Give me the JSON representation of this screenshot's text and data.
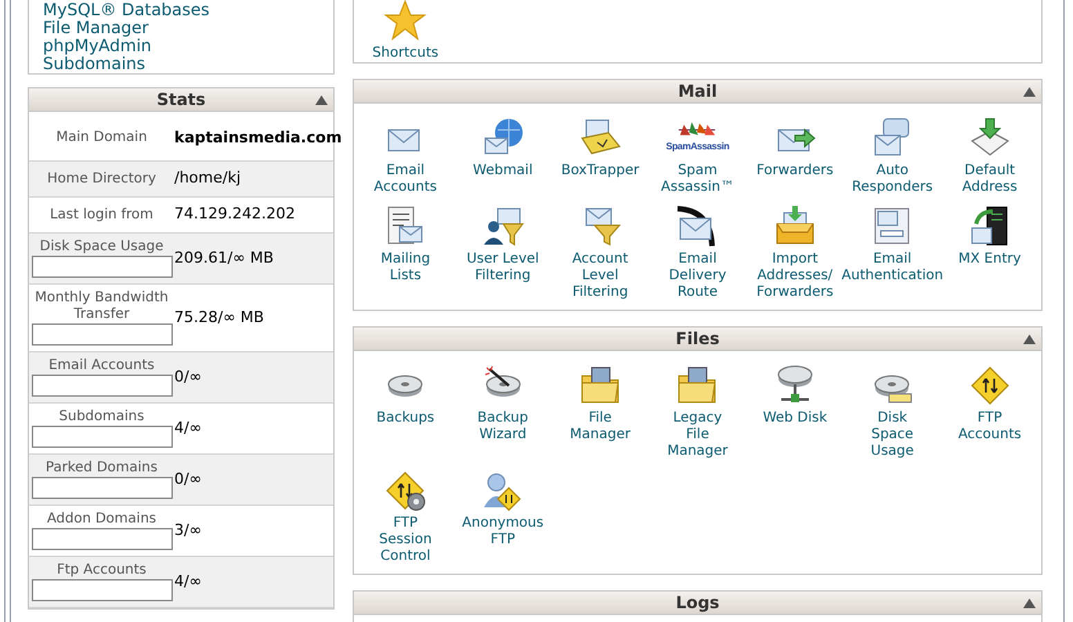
{
  "sidebar_links": [
    "MySQL® Databases",
    "File Manager",
    "phpMyAdmin",
    "Subdomains"
  ],
  "stats": {
    "title": "Stats",
    "rows": [
      {
        "kind": "text",
        "label": "Main Domain",
        "value": "kaptainsmedia.com",
        "bold": true
      },
      {
        "kind": "text",
        "label": "Home Directory",
        "value": "/home/kj",
        "bold": false
      },
      {
        "kind": "text",
        "label": "Last login from",
        "value": "74.129.242.202",
        "bold": false
      },
      {
        "kind": "meter",
        "label": "Disk Space Usage",
        "value": "209.61/∞ MB",
        "level": 0
      },
      {
        "kind": "meter",
        "label": "Monthly Bandwidth Transfer",
        "value": "75.28/∞ MB",
        "level": 0
      },
      {
        "kind": "meter",
        "label": "Email Accounts",
        "value": "0/∞",
        "level": 0
      },
      {
        "kind": "meter",
        "label": "Subdomains",
        "value": "4/∞",
        "level": 0
      },
      {
        "kind": "meter",
        "label": "Parked Domains",
        "value": "0/∞",
        "level": 0
      },
      {
        "kind": "meter",
        "label": "Addon Domains",
        "value": "3/∞",
        "level": 0
      },
      {
        "kind": "meter",
        "label": "Ftp Accounts",
        "value": "4/∞",
        "level": 0
      }
    ]
  },
  "shortcuts": [
    {
      "kind": "star",
      "lines": [
        "Shortcuts"
      ]
    }
  ],
  "sections": [
    {
      "title": "Mail",
      "tools": [
        {
          "kind": "envelope",
          "lines": [
            "Email",
            "Accounts"
          ]
        },
        {
          "kind": "globe",
          "lines": [
            "Webmail"
          ]
        },
        {
          "kind": "lock",
          "lines": [
            "BoxTrapper"
          ]
        },
        {
          "kind": "spam",
          "logo_text": "SpamAssassin",
          "lines": [
            "Spam",
            "Assassin™"
          ]
        },
        {
          "kind": "arrow",
          "lines": [
            "Forwarders"
          ]
        },
        {
          "kind": "speech",
          "lines": [
            "Auto",
            "Responders"
          ]
        },
        {
          "kind": "download",
          "lines": [
            "Default",
            "Address"
          ]
        },
        {
          "kind": "list",
          "lines": [
            "Mailing",
            "Lists"
          ]
        },
        {
          "kind": "user",
          "lines": [
            "User Level",
            "Filtering"
          ]
        },
        {
          "kind": "funnel",
          "lines": [
            "Account",
            "Level",
            "Filtering"
          ]
        },
        {
          "kind": "route",
          "lines": [
            "Email",
            "Delivery",
            "Route"
          ]
        },
        {
          "kind": "tray",
          "lines": [
            "Import",
            "Addresses/",
            "Forwarders"
          ]
        },
        {
          "kind": "card",
          "lines": [
            "Email",
            "Authentication"
          ]
        },
        {
          "kind": "server",
          "lines": [
            "MX Entry"
          ]
        }
      ]
    },
    {
      "title": "Files",
      "tools": [
        {
          "kind": "disk",
          "lines": [
            "Backups"
          ]
        },
        {
          "kind": "wand",
          "lines": [
            "Backup",
            "Wizard"
          ]
        },
        {
          "kind": "folder",
          "lines": [
            "File",
            "Manager"
          ]
        },
        {
          "kind": "folder",
          "lines": [
            "Legacy",
            "File",
            "Manager"
          ]
        },
        {
          "kind": "netdisk",
          "lines": [
            "Web Disk"
          ]
        },
        {
          "kind": "diskmeter",
          "lines": [
            "Disk",
            "Space",
            "Usage"
          ]
        },
        {
          "kind": "warning",
          "lines": [
            "FTP",
            "Accounts"
          ]
        },
        {
          "kind": "gearwarning",
          "lines": [
            "FTP",
            "Session",
            "Control"
          ]
        },
        {
          "kind": "people",
          "lines": [
            "Anonymous",
            "FTP"
          ]
        }
      ]
    },
    {
      "title": "Logs"
    }
  ]
}
